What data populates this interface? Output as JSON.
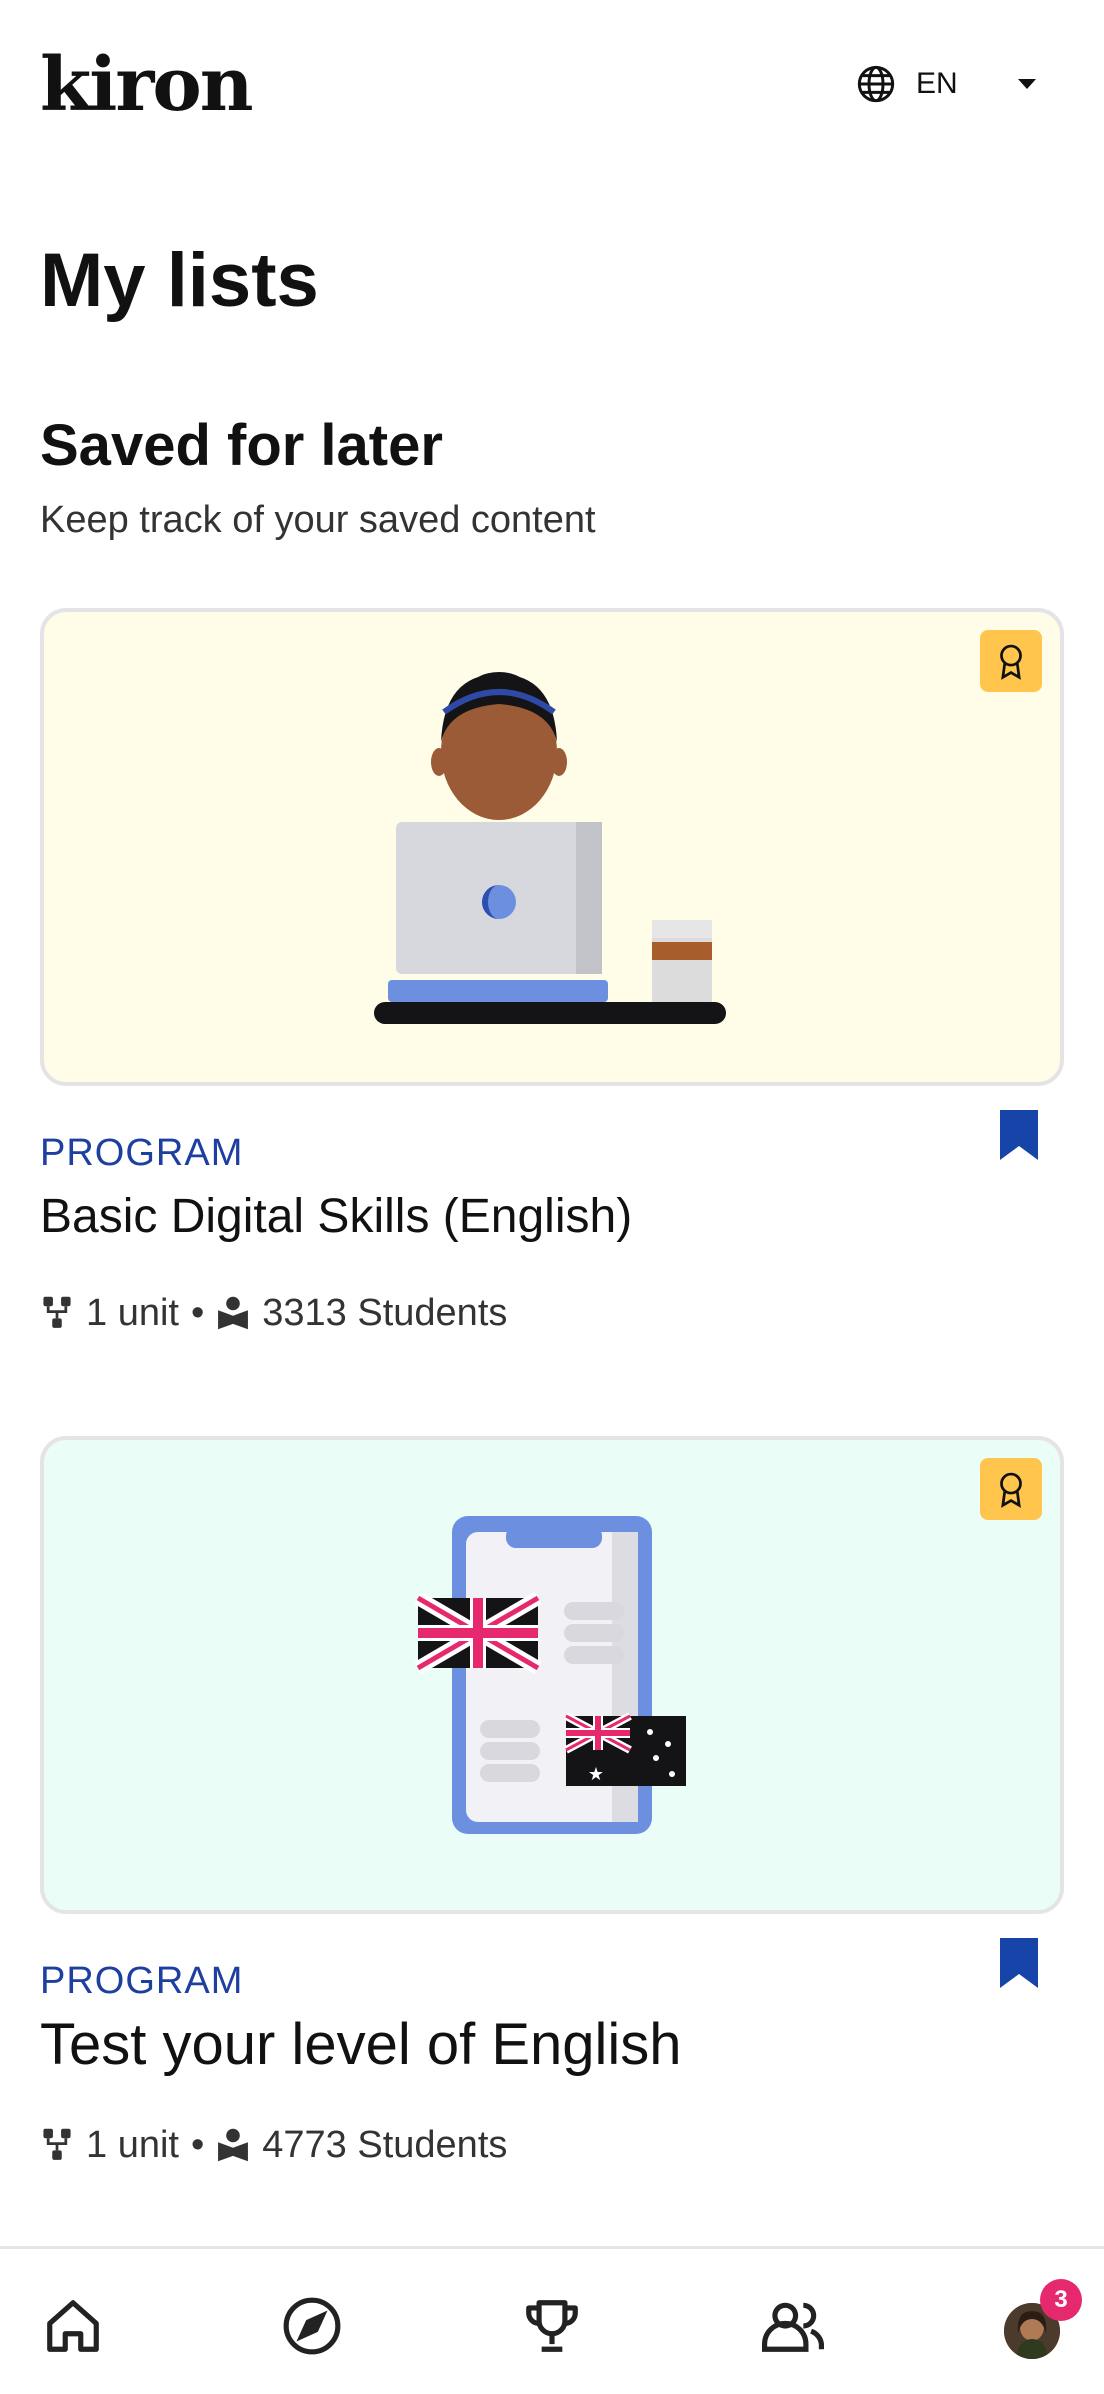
{
  "header": {
    "logo_text": "kiron",
    "language": "EN",
    "globe_icon": "globe-icon",
    "caret_icon": "chevron-down-icon"
  },
  "page_title": "My lists",
  "section": {
    "title": "Saved for later",
    "subtitle": "Keep track of your saved content"
  },
  "cards": [
    {
      "type": "PROGRAM",
      "title": "Basic Digital Skills (English)",
      "units": "1 unit",
      "separator": "•",
      "students": "3313 Students",
      "background": "#fffde8",
      "badge_icon": "award-icon",
      "bookmark_icon": "bookmark-icon"
    },
    {
      "type": "PROGRAM",
      "title": "Test your level of English",
      "units": "1 unit",
      "separator": "•",
      "students": "4773 Students",
      "background": "#ebfdf7",
      "badge_icon": "award-icon",
      "bookmark_icon": "bookmark-icon"
    }
  ],
  "bottom_nav": {
    "items": [
      "home-icon",
      "explore-icon",
      "trophy-icon",
      "community-icon",
      "profile-avatar"
    ],
    "notification_count": "3"
  },
  "colors": {
    "accent": "#1d3f9f",
    "bookmark": "#1744a8",
    "badge": "#ffc54d",
    "notification": "#e6286f"
  }
}
